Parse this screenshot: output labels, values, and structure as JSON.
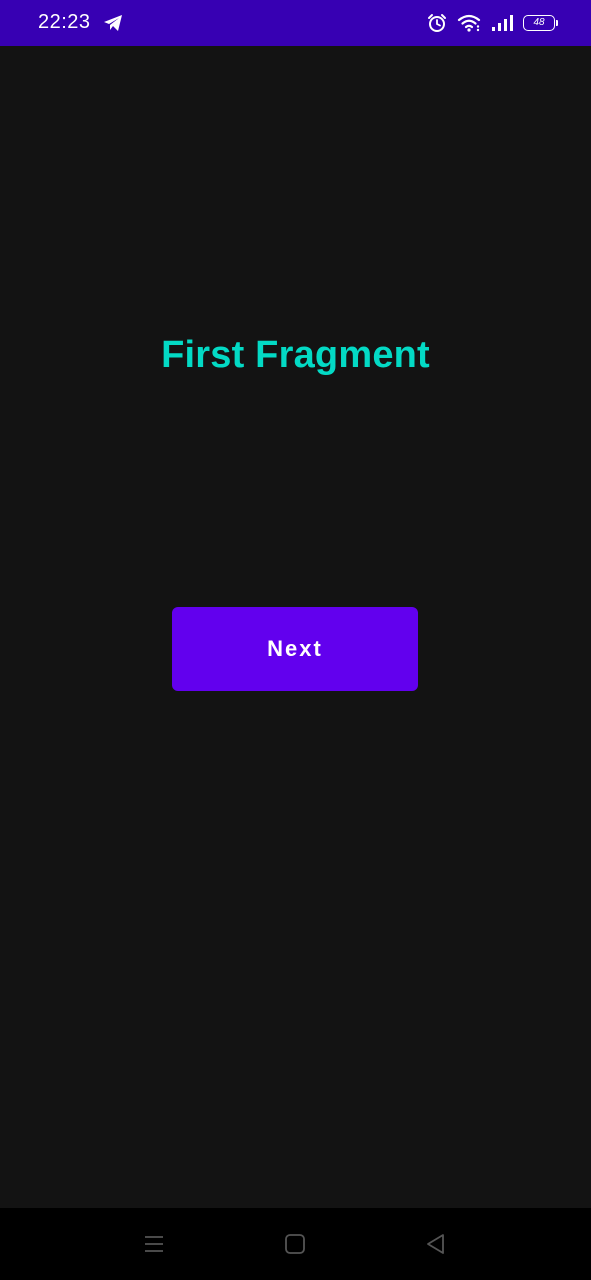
{
  "status_bar": {
    "time": "22:23",
    "battery_level": "48",
    "icons": [
      "telegram-icon",
      "alarm-icon",
      "wifi-icon",
      "signal-icon",
      "battery-icon"
    ],
    "background_color": "#3700B3"
  },
  "main": {
    "title": "First Fragment",
    "title_color": "#03DAC5",
    "next_button_label": "Next",
    "button_color": "#6200EE",
    "background_color": "#131313"
  },
  "nav_bar": {
    "icons": [
      "menu-icon",
      "home-icon",
      "back-icon"
    ]
  }
}
